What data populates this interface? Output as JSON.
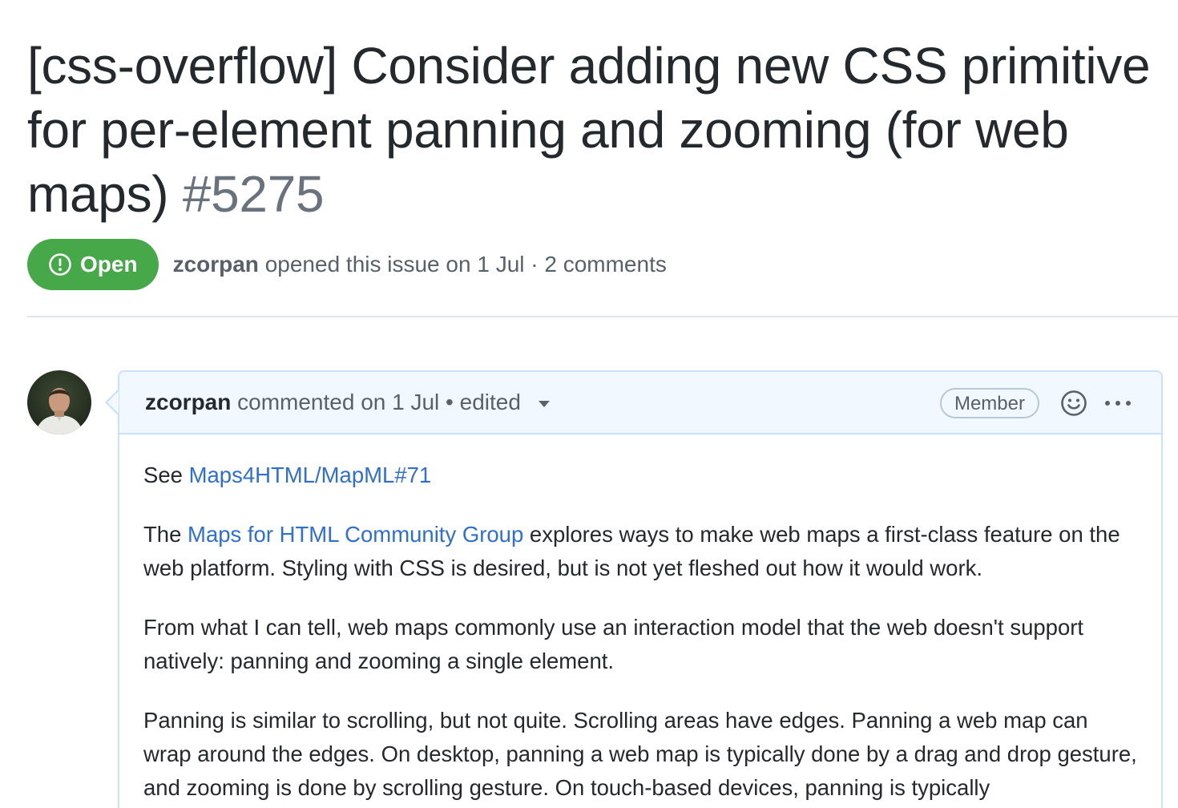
{
  "issue": {
    "title": "[css-overflow] Consider adding new CSS primitive for per-element panning and zooming (for web maps)",
    "number": "#5275",
    "state": "Open",
    "author": "zcorpan",
    "opened_text": "opened this issue on 1 Jul · 2 comments"
  },
  "comment": {
    "author": "zcorpan",
    "meta_text": "commented on 1 Jul • edited",
    "role_badge": "Member",
    "body": {
      "p1_prefix": "See ",
      "p1_link": "Maps4HTML/MapML#71",
      "p2_prefix": "The ",
      "p2_link": "Maps for HTML Community Group",
      "p2_suffix": " explores ways to make web maps a first-class feature on the web platform. Styling with CSS is desired, but is not yet fleshed out how it would work.",
      "p3": "From what I can tell, web maps commonly use an interaction model that the web doesn't support natively: panning and zooming a single element.",
      "p4": "Panning is similar to scrolling, but not quite. Scrolling areas have edges. Panning a web map can wrap around the edges. On desktop, panning a web map is typically done by a drag and drop gesture, and zooming is done by scrolling gesture. On touch-based devices, panning is typically"
    }
  },
  "colors": {
    "open_badge": "#46a849",
    "link": "#2d6fd6",
    "comment_border": "#c8e1ff",
    "comment_header_bg": "#f1f8ff"
  },
  "icons": {
    "state": "issue-opened-icon",
    "emoji": "smiley-icon",
    "more": "kebab-horizontal-icon",
    "edited": "triangle-down-icon"
  }
}
